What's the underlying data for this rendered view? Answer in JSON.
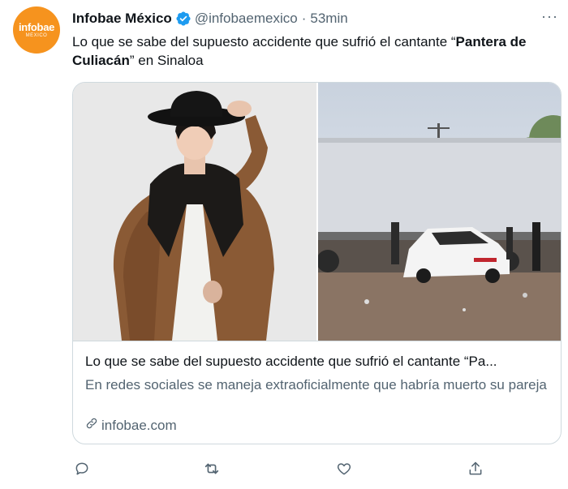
{
  "account": {
    "avatar_brand": "infobae",
    "avatar_sub": "MÉXICO",
    "name": "Infobae México",
    "handle": "@infobaemexico",
    "separator": "·",
    "time": "53min",
    "more": "···"
  },
  "tweet": {
    "text_before": "Lo que se sabe del supuesto accidente que sufrió el cantante “",
    "text_bold": "Pantera de Culiacán",
    "text_after": "” en Sinaloa"
  },
  "card": {
    "title": "Lo que se sabe del supuesto accidente que sufrió el cantante “Pa...",
    "description": "En redes sociales se maneja extraoficialmente que habría muerto su pareja",
    "domain": "infobae.com"
  },
  "icons": {
    "verified": "verified-badge-icon",
    "link": "link-icon",
    "reply": "reply-icon",
    "retweet": "retweet-icon",
    "like": "heart-icon",
    "share": "share-icon"
  },
  "colors": {
    "brand_orange": "#f6931e",
    "verified_blue": "#1d9bf0",
    "secondary_text": "#536471",
    "border": "#cfd9de"
  }
}
